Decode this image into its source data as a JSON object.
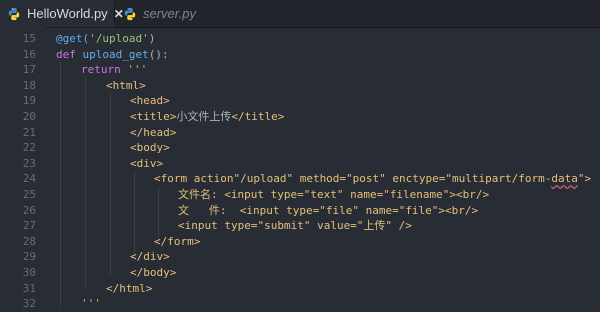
{
  "tabs": [
    {
      "label": "HelloWorld.py",
      "close_glyph": "✕",
      "active": true,
      "icon": "python-icon"
    },
    {
      "label": "server.py",
      "active": false,
      "icon": "python-icon"
    }
  ],
  "colors": {
    "editor_bg": "#282c34",
    "tabbar_bg": "#21252b",
    "line_number": "#636d83",
    "keyword": "#c678dd",
    "function": "#61afef",
    "string": "#98c379",
    "html_tag": "#e5c07b",
    "plain_text": "#abb2bf",
    "error_squiggle": "#e06c75"
  },
  "line_numbers": [
    "15",
    "16",
    "17",
    "18",
    "19",
    "20",
    "21",
    "22",
    "23",
    "24",
    "25",
    "26",
    "27",
    "28",
    "29",
    "30",
    "31",
    "32"
  ],
  "code": {
    "l15": {
      "decorator": "@get(",
      "arg": "'/upload'",
      "close": ")"
    },
    "l16": {
      "kw": "def ",
      "fn": "upload_get",
      "rest": "():"
    },
    "l17": {
      "kw": "return ",
      "str": "'''"
    },
    "l18": {
      "text": "<html>"
    },
    "l19": {
      "text": "<head>"
    },
    "l20": {
      "open": "<title>",
      "inner": "小文件上传",
      "close": "</title>"
    },
    "l21": {
      "text": "</head>"
    },
    "l22": {
      "text": "<body>"
    },
    "l23": {
      "text": "<div>"
    },
    "l24": {
      "pre": "<form action\"/upload\" method=\"post\" enctype=\"multipart/form-",
      "err": "data",
      "post": "\">"
    },
    "l25": {
      "label": "文件名: ",
      "tag": "<input type=\"text\" name=\"filename\"><br/>"
    },
    "l26": {
      "label": "文   件:  ",
      "tag": "<input type=\"file\" name=\"file\"><br/>"
    },
    "l27": {
      "text": "<input type=\"submit\" value=\"上传\" />"
    },
    "l28": {
      "text": "</form>"
    },
    "l29": {
      "text": "</div>"
    },
    "l30": {
      "text": "</body>"
    },
    "l31": {
      "text": "</html>"
    },
    "l32": {
      "str": "'''"
    }
  }
}
